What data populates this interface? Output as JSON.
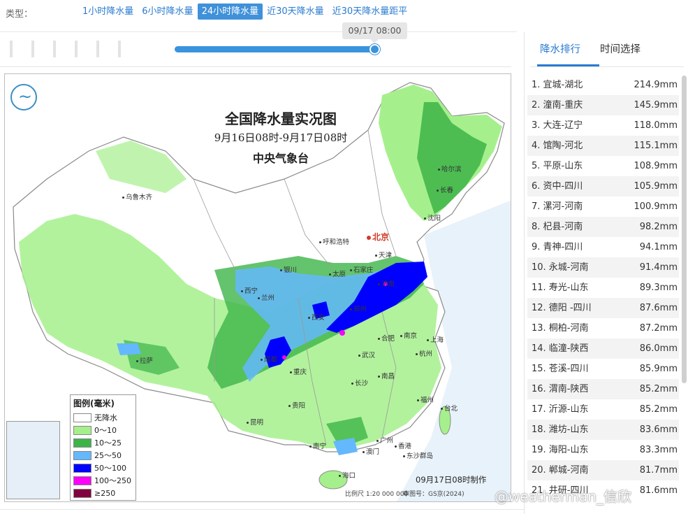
{
  "typebar": {
    "label": "类型：",
    "tabs": [
      {
        "label": "1小时降水量",
        "active": false
      },
      {
        "label": "6小时降水量",
        "active": false
      },
      {
        "label": "24小时降水量",
        "active": true
      },
      {
        "label": "近30天降水量",
        "active": false
      },
      {
        "label": "近30天降水量距平",
        "active": false
      }
    ]
  },
  "timeline": {
    "current_time": "09/17 08:00"
  },
  "map": {
    "title": "全国降水量实况图",
    "subtitle": "9月16日08时-9月17日08时",
    "agency": "中央气象台",
    "made_time": "09月17日08时制作",
    "scale": "比例尺  1:20 000 000",
    "review_no": "审图号：GS京(2024)",
    "cities": [
      {
        "name": "哈尔滨"
      },
      {
        "name": "长春"
      },
      {
        "name": "沈阳"
      },
      {
        "name": "乌鲁木齐"
      },
      {
        "name": "呼和浩特"
      },
      {
        "name": "北京",
        "capital": true
      },
      {
        "name": "天津"
      },
      {
        "name": "石家庄"
      },
      {
        "name": "太原"
      },
      {
        "name": "济南"
      },
      {
        "name": "银川"
      },
      {
        "name": "西宁"
      },
      {
        "name": "兰州"
      },
      {
        "name": "郑州"
      },
      {
        "name": "西安"
      },
      {
        "name": "南京"
      },
      {
        "name": "合肥"
      },
      {
        "name": "上海"
      },
      {
        "name": "杭州"
      },
      {
        "name": "拉萨"
      },
      {
        "name": "成都"
      },
      {
        "name": "武汉"
      },
      {
        "name": "重庆"
      },
      {
        "name": "南昌"
      },
      {
        "name": "长沙"
      },
      {
        "name": "福州"
      },
      {
        "name": "台北"
      },
      {
        "name": "贵阳"
      },
      {
        "name": "昆明"
      },
      {
        "name": "南宁"
      },
      {
        "name": "广州"
      },
      {
        "name": "香港"
      },
      {
        "name": "澳门"
      },
      {
        "name": "海口"
      },
      {
        "name": "东沙群岛"
      }
    ],
    "legend": {
      "title": "图例(毫米)",
      "items": [
        {
          "label": "无降水",
          "color": "#ffffff"
        },
        {
          "label": "0～10",
          "color": "#a5f08c"
        },
        {
          "label": "10～25",
          "color": "#3db448"
        },
        {
          "label": "25～50",
          "color": "#64b8fd"
        },
        {
          "label": "50～100",
          "color": "#0000fe"
        },
        {
          "label": "100～250",
          "color": "#fb00fa"
        },
        {
          "label": "≥250",
          "color": "#800040"
        }
      ]
    }
  },
  "panel": {
    "tabs": [
      {
        "label": "降水排行",
        "active": true
      },
      {
        "label": "时间选择",
        "active": false
      }
    ],
    "ranking": [
      {
        "station": "1. 宜城-湖北",
        "value": "214.9mm"
      },
      {
        "station": "2. 潼南-重庆",
        "value": "145.9mm"
      },
      {
        "station": "3. 大连-辽宁",
        "value": "118.0mm"
      },
      {
        "station": "4. 馆陶-河北",
        "value": "115.1mm"
      },
      {
        "station": "5. 平原-山东",
        "value": "108.9mm"
      },
      {
        "station": "6. 资中-四川",
        "value": "105.9mm"
      },
      {
        "station": "7. 漯河-河南",
        "value": "100.9mm"
      },
      {
        "station": "8. 杞县-河南",
        "value": "98.2mm"
      },
      {
        "station": "9. 青神-四川",
        "value": "94.1mm"
      },
      {
        "station": "10. 永城-河南",
        "value": "91.4mm"
      },
      {
        "station": "11. 寿光-山东",
        "value": "89.3mm"
      },
      {
        "station": "12. 德阳 -四川",
        "value": "87.6mm"
      },
      {
        "station": "13. 桐柏-河南",
        "value": "87.2mm"
      },
      {
        "station": "14. 临潼-陕西",
        "value": "86.0mm"
      },
      {
        "station": "15. 苍溪-四川",
        "value": "85.9mm"
      },
      {
        "station": "16. 渭南-陕西",
        "value": "85.2mm"
      },
      {
        "station": "17. 沂源-山东",
        "value": "85.2mm"
      },
      {
        "station": "18. 潍坊-山东",
        "value": "83.6mm"
      },
      {
        "station": "19. 海阳-山东",
        "value": "83.3mm"
      },
      {
        "station": "20. 郸城-河南",
        "value": "81.7mm"
      },
      {
        "station": "21. 井研-四川",
        "value": "81.6mm"
      }
    ]
  },
  "watermark": "@weatherman_信欣"
}
